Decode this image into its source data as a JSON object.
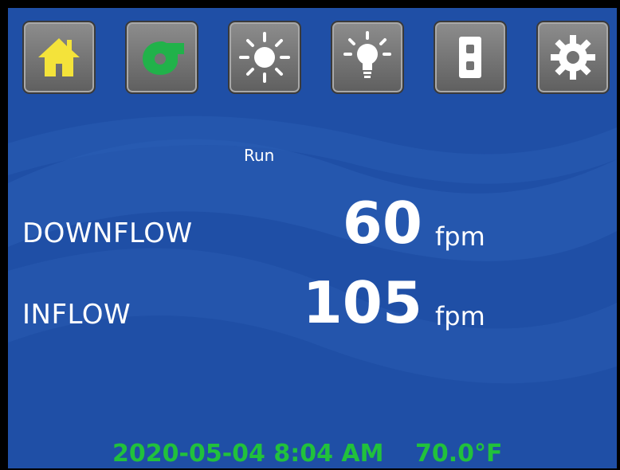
{
  "toolbar": {
    "buttons": [
      {
        "icon": "home-icon",
        "active_color": "#f4e33a"
      },
      {
        "icon": "blower-icon",
        "active_color": "#21b24a"
      },
      {
        "icon": "sun-icon"
      },
      {
        "icon": "light-bulb-icon"
      },
      {
        "icon": "outlet-icon"
      },
      {
        "icon": "gear-icon"
      }
    ]
  },
  "main": {
    "status": "Run",
    "downflow": {
      "label": "DOWNFLOW",
      "value": "60",
      "unit": "fpm"
    },
    "inflow": {
      "label": "INFLOW",
      "value": "105",
      "unit": "fpm"
    }
  },
  "footer": {
    "datetime": "2020-05-04 8:04 AM",
    "temperature": "70.0°F"
  },
  "colors": {
    "background": "#1f4fa6",
    "footer_text": "#21c13c"
  }
}
